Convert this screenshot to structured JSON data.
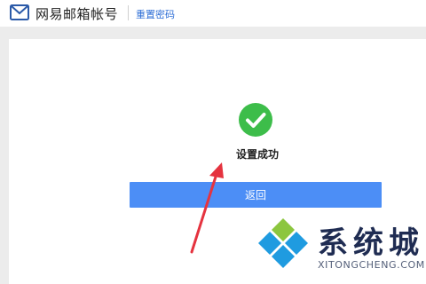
{
  "header": {
    "brand_name": "网易邮箱帐号",
    "breadcrumb": "重置密码"
  },
  "result": {
    "message": "设置成功"
  },
  "actions": {
    "back_label": "返回"
  },
  "watermark": {
    "title": "系统城",
    "url": "XITONGCHENG.COM"
  },
  "colors": {
    "accent": "#4c8ef6",
    "success": "#3dbd4a",
    "link": "#2f6fd6",
    "annotation_arrow": "#e5333f"
  },
  "icons": {
    "logo": "envelope-icon",
    "success": "checkmark-circle-icon"
  }
}
